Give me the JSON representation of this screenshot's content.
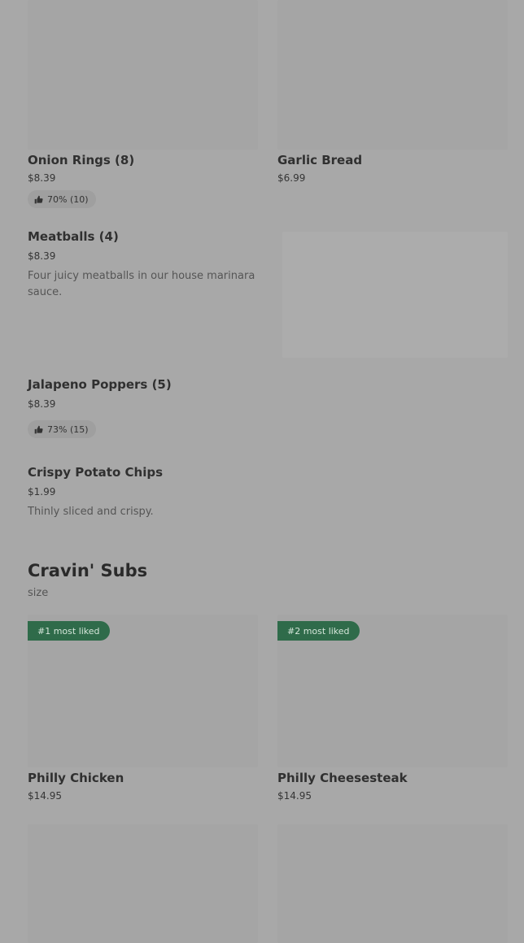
{
  "items": {
    "onion_rings": {
      "title": "Onion Rings (8)",
      "price": "$8.39",
      "rating": "70% (10)"
    },
    "garlic_bread": {
      "title": "Garlic Bread",
      "price": "$6.99"
    },
    "meatballs": {
      "title": "Meatballs (4)",
      "price": "$8.39",
      "description": "Four juicy meatballs in our house marinara sauce."
    },
    "jalapeno_poppers": {
      "title": "Jalapeno Poppers (5)",
      "price": "$8.39",
      "rating": "73% (15)"
    },
    "potato_chips": {
      "title": "Crispy Potato Chips",
      "price": "$1.99",
      "description": "Thinly sliced and crispy."
    }
  },
  "subs_section": {
    "title": "Cravin' Subs",
    "subtitle": "size",
    "items": [
      {
        "badge": "#1 most liked",
        "title": "Philly Chicken",
        "price": "$14.95"
      },
      {
        "badge": "#2 most liked",
        "title": "Philly Cheesesteak",
        "price": "$14.95"
      }
    ]
  },
  "icons": {
    "rating": "thumbs-up-icon"
  }
}
